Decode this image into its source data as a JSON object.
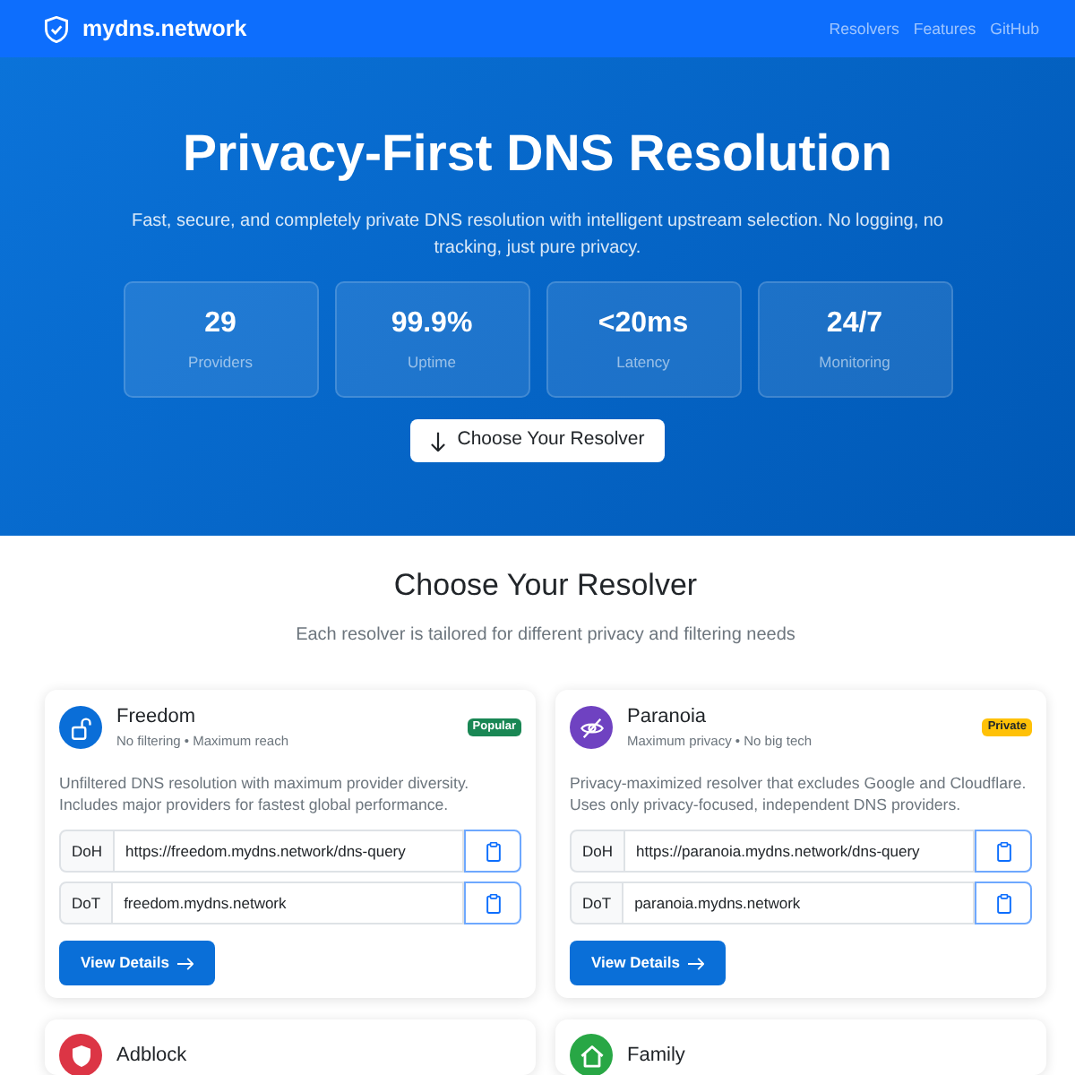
{
  "navbar": {
    "brand": "mydns.network",
    "links": [
      "Resolvers",
      "Features",
      "GitHub"
    ]
  },
  "hero": {
    "title": "Privacy-First DNS Resolution",
    "subtitle": "Fast, secure, and completely private DNS resolution with intelligent upstream selection. No logging, no tracking, just pure privacy.",
    "stats": [
      {
        "value": "29",
        "label": "Providers"
      },
      {
        "value": "99.9%",
        "label": "Uptime"
      },
      {
        "value": "<20ms",
        "label": "Latency"
      },
      {
        "value": "24/7",
        "label": "Monitoring"
      }
    ],
    "button": "Choose Your Resolver"
  },
  "resolvers_section": {
    "title": "Choose Your Resolver",
    "subtitle": "Each resolver is tailored for different privacy and filtering needs",
    "resolvers": [
      {
        "name": "Freedom",
        "tagline": "No filtering • Maximum reach",
        "color": "#0a6ed8",
        "badge": {
          "text": "Popular",
          "color": "#198754"
        },
        "description": "Unfiltered DNS resolution with maximum provider diversity. Includes major providers for fastest global performance.",
        "endpoints": [
          {
            "protocol": "DoH",
            "address": "https://freedom.mydns.network/dns-query"
          },
          {
            "protocol": "DoT",
            "address": "freedom.mydns.network"
          }
        ],
        "button": "View Details"
      },
      {
        "name": "Paranoia",
        "tagline": "Maximum privacy • No big tech",
        "color": "#6f42c1",
        "badge": {
          "text": "Private",
          "color": "#ffc107"
        },
        "description": "Privacy-maximized resolver that excludes Google and Cloudflare. Uses only privacy-focused, independent DNS providers.",
        "endpoints": [
          {
            "protocol": "DoH",
            "address": "https://paranoia.mydns.network/dns-query"
          },
          {
            "protocol": "DoT",
            "address": "paranoia.mydns.network"
          }
        ],
        "button": "View Details"
      },
      {
        "name": "Adblock",
        "color": "#dc3545"
      },
      {
        "name": "Family",
        "color": "#28a745"
      }
    ]
  }
}
